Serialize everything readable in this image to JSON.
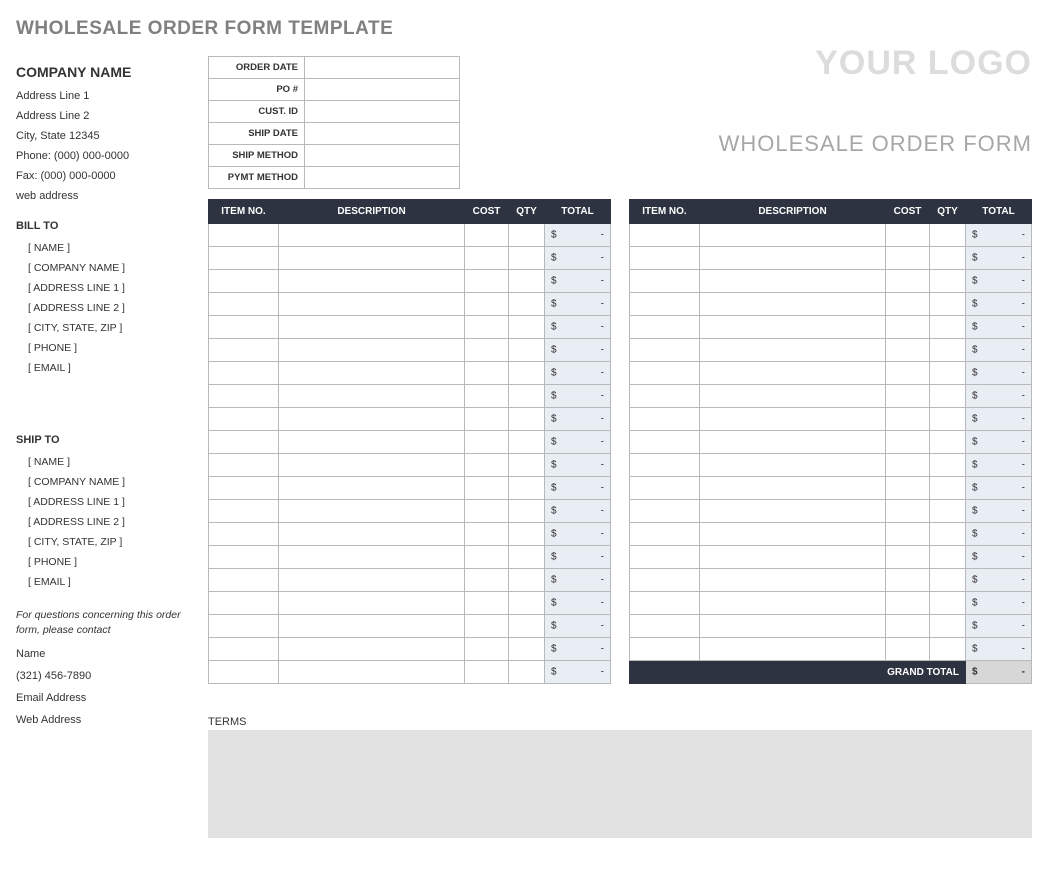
{
  "page_title": "WHOLESALE ORDER FORM TEMPLATE",
  "company": {
    "name_label": "COMPANY NAME",
    "address1": "Address Line 1",
    "address2": "Address Line 2",
    "city_state_zip": "City, State  12345",
    "phone": "Phone: (000) 000-0000",
    "fax": "Fax: (000) 000-0000",
    "web": "web address"
  },
  "logo_text": "YOUR LOGO",
  "form_title": "WHOLESALE ORDER FORM",
  "meta_labels": {
    "order_date": "ORDER DATE",
    "po": "PO #",
    "cust_id": "CUST. ID",
    "ship_date": "SHIP DATE",
    "ship_method": "SHIP METHOD",
    "pymt_method": "PYMT METHOD"
  },
  "bill_to": {
    "heading": "BILL TO",
    "name": "[ NAME ]",
    "company": "[ COMPANY NAME ]",
    "addr1": "[ ADDRESS LINE 1 ]",
    "addr2": "[ ADDRESS LINE 2 ]",
    "csz": "[ CITY, STATE, ZIP ]",
    "phone": "[ PHONE ]",
    "email": "[ EMAIL ]"
  },
  "ship_to": {
    "heading": "SHIP TO",
    "name": "[ NAME ]",
    "company": "[ COMPANY NAME ]",
    "addr1": "[ ADDRESS LINE 1 ]",
    "addr2": "[ ADDRESS LINE 2 ]",
    "csz": "[ CITY, STATE, ZIP ]",
    "phone": "[ PHONE ]",
    "email": "[ EMAIL ]"
  },
  "items_header": {
    "item_no": "ITEM NO.",
    "description": "DESCRIPTION",
    "cost": "COST",
    "qty": "QTY",
    "total": "TOTAL"
  },
  "currency": "$",
  "dash": "-",
  "left_rows": 20,
  "right_rows": 19,
  "grand_total_label": "GRAND TOTAL",
  "contact": {
    "note": "For questions concerning this order form, please contact",
    "name": "Name",
    "phone": "(321) 456-7890",
    "email": "Email Address",
    "web": "Web Address"
  },
  "terms_label": "TERMS"
}
